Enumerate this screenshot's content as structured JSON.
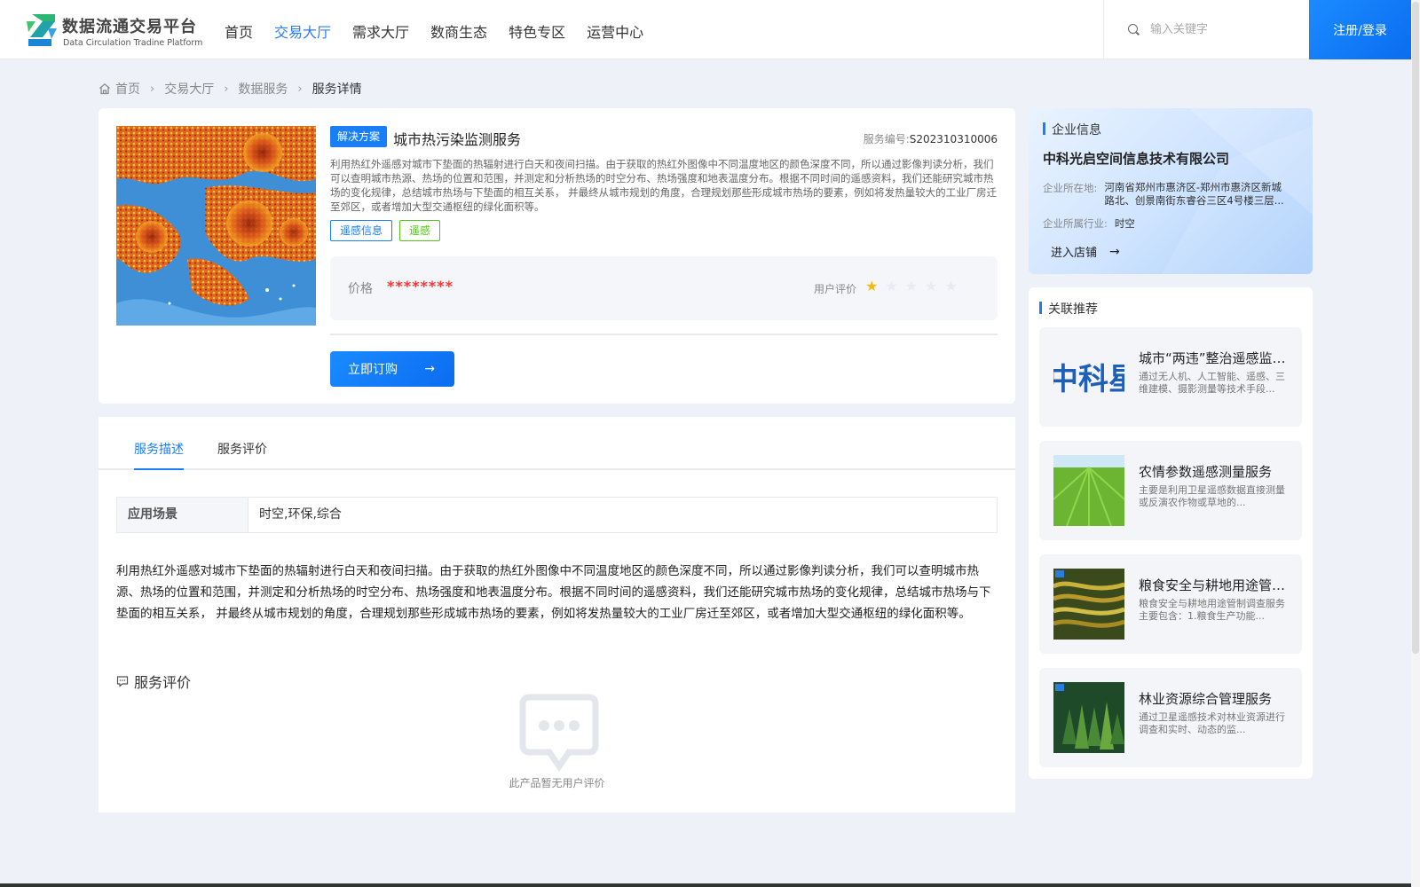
{
  "header": {
    "logo_cn": "数据流通交易平台",
    "logo_en": "Data Circulation Tradine Platform",
    "nav": [
      {
        "label": "首页",
        "active": false
      },
      {
        "label": "交易大厅",
        "active": true
      },
      {
        "label": "需求大厅",
        "active": false
      },
      {
        "label": "数商生态",
        "active": false
      },
      {
        "label": "特色专区",
        "active": false
      },
      {
        "label": "运营中心",
        "active": false
      }
    ],
    "search_placeholder": "输入关键字",
    "login_label": "注册/登录"
  },
  "breadcrumb": [
    "首页",
    "交易大厅",
    "数据服务",
    "服务详情"
  ],
  "product": {
    "badge": "解决方案",
    "title": "城市热污染监测服务",
    "service_no_label": "服务编号:",
    "service_no": "S202310310006",
    "description": "利用热红外遥感对城市下垫面的热辐射进行白天和夜间扫描。由于获取的热红外图像中不同温度地区的颜色深度不同，所以通过影像判读分析，我们可以查明城市热源、热场的位置和范围，并测定和分析热场的时空分布、热场强度和地表温度分布。根据不同时间的遥感资料，我们还能研究城市热场的变化规律，总结城市热场与下垫面的相互关系， 并最终从城市规划的角度，合理规划那些形成城市热场的要素，例如将发热量较大的工业厂房迁至郊区，或者增加大型交通枢纽的绿化面积等。",
    "tags": [
      "遥感信息",
      "遥感"
    ],
    "price_label": "价格",
    "price_value": "********",
    "rating_label": "用户评价",
    "rating": 1,
    "rating_max": 5,
    "buy_label": "立即订购"
  },
  "detail": {
    "tabs": [
      {
        "label": "服务描述",
        "active": true
      },
      {
        "label": "服务评价",
        "active": false
      }
    ],
    "scene_label": "应用场景",
    "scene_value": "时空,环保,综合",
    "text": "利用热红外遥感对城市下垫面的热辐射进行白天和夜间扫描。由于获取的热红外图像中不同温度地区的颜色深度不同，所以通过影像判读分析，我们可以查明城市热源、热场的位置和范围，并测定和分析热场的时空分布、热场强度和地表温度分布。根据不同时间的遥感资料，我们还能研究城市热场的变化规律，总结城市热场与下垫面的相互关系， 并最终从城市规划的角度，合理规划那些形成城市热场的要素，例如将发热量较大的工业厂房迁至郊区，或者增加大型交通枢纽的绿化面积等。",
    "review_title": "服务评价",
    "empty_text": "此产品暂无用户评价"
  },
  "company": {
    "section_title": "企业信息",
    "name": "中科光启空间信息技术有限公司",
    "location_label": "企业所在地:",
    "location": "河南省郑州市惠济区-郑州市惠济区新城路北、创景南街东睿谷三区4号楼三层...",
    "industry_label": "企业所属行业:",
    "industry": "时空",
    "enter_label": "进入店铺"
  },
  "recommend": {
    "section_title": "关联推荐",
    "items": [
      {
        "title": "城市“两违”整治遥感监测服务",
        "desc": "通过无人机、人工智能、遥感、三维建模、摄影测量等技术手段...",
        "thumb_text": "中科星"
      },
      {
        "title": "农情参数遥感测量服务",
        "desc": "主要是利用卫星遥感数据直接测量或反演农作物或草地的..."
      },
      {
        "title": "粮食安全与耕地用途管制调查服务",
        "desc": "粮食安全与耕地用途管制调查服务主要包含：1.粮食生产功能..."
      },
      {
        "title": "林业资源综合管理服务",
        "desc": "通过卫星遥感技术对林业资源进行调查和实时、动态的监..."
      }
    ]
  },
  "colors": {
    "accent": "#1a7ff7",
    "price": "#ff3333",
    "star": "#f5b814",
    "tag_green": "#52c41a"
  }
}
